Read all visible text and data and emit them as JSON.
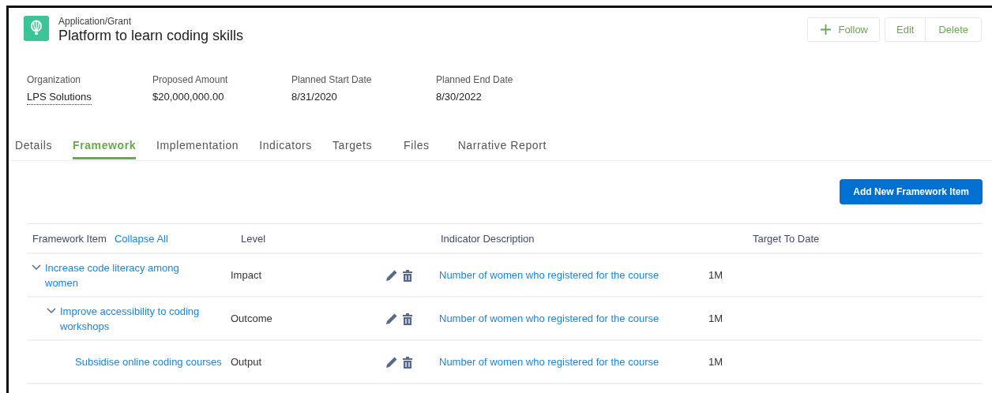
{
  "header": {
    "object_type": "Application/Grant",
    "title": "Platform to learn coding skills"
  },
  "actions": [
    {
      "label": "Follow",
      "kind": "follow"
    },
    {
      "label": "Edit",
      "kind": "plain"
    },
    {
      "label": "Delete",
      "kind": "plain"
    }
  ],
  "fields": [
    {
      "label": "Organization",
      "value": "LPS Solutions",
      "kind": "lookup"
    },
    {
      "label": "Proposed Amount",
      "value": "$20,000,000.00",
      "kind": "text"
    },
    {
      "label": "Planned Start Date",
      "value": "8/31/2020",
      "kind": "text"
    },
    {
      "label": "Planned End Date",
      "value": "8/30/2022",
      "kind": "text"
    }
  ],
  "tabs": [
    {
      "label": "Details",
      "selected": false
    },
    {
      "label": "Framework",
      "selected": true
    },
    {
      "label": "Implementation",
      "selected": false
    },
    {
      "label": "Indicators",
      "selected": false
    },
    {
      "label": "Targets",
      "selected": false
    },
    {
      "label": "Files",
      "selected": false
    },
    {
      "label": "Narrative Report",
      "selected": false
    }
  ],
  "add_button": "Add New Framework Item",
  "table": {
    "columns": [
      "Framework Item",
      "Level",
      "Indicator Description",
      "Target To Date"
    ],
    "collapse_all": "Collapse All",
    "rows": [
      {
        "item": "Increase code literacy among women",
        "level": "Impact",
        "indicator": "Number of women who registered for the course",
        "target": "1M",
        "expanded": true,
        "children": [
          {
            "item": "Improve accessibility to coding workshops",
            "level": "Outcome",
            "indicator": "Number of women who registered for the course",
            "target": "1M",
            "expanded": true,
            "children": [
              {
                "item": "Subsidise online coding courses",
                "level": "Output",
                "indicator": "Number of women who registered for the course",
                "target": "1M"
              }
            ]
          }
        ]
      }
    ]
  }
}
